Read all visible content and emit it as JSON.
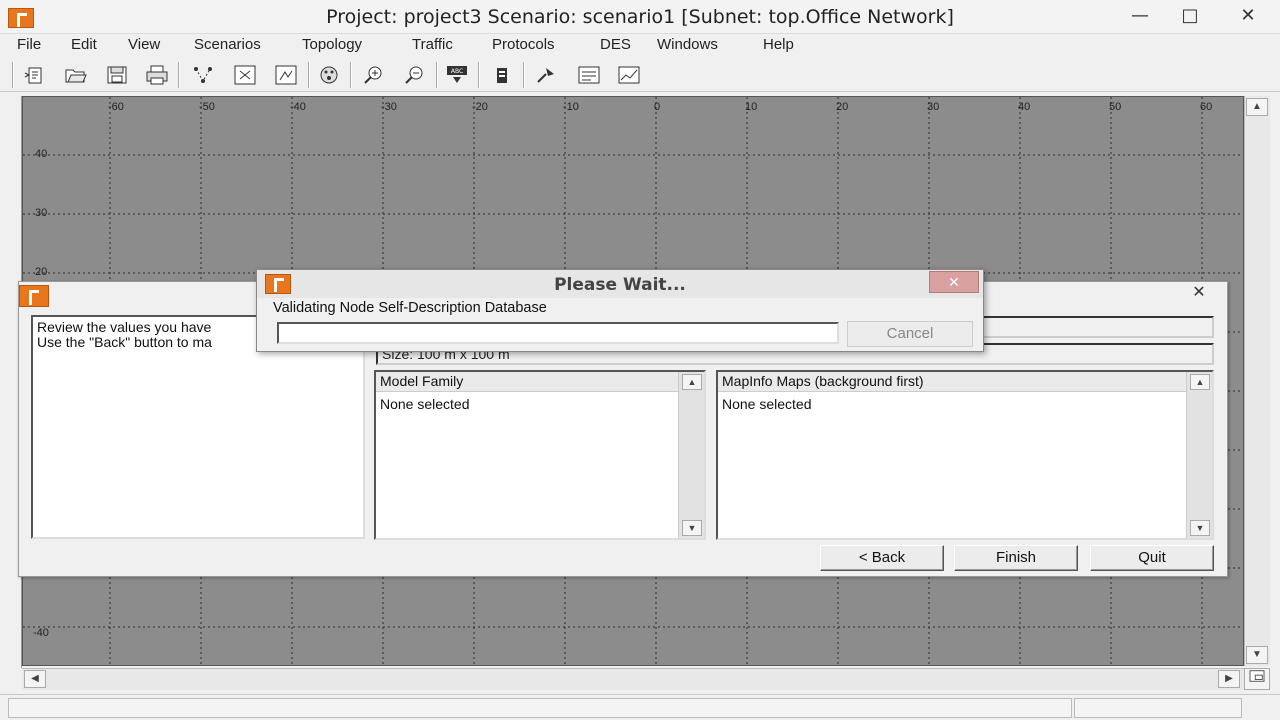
{
  "window": {
    "title": "Project: project3 Scenario: scenario1  [Subnet: top.Office Network]",
    "minimize": "—",
    "maximize": "□",
    "close": "✕"
  },
  "menu": [
    "File",
    "Edit",
    "View",
    "Scenarios",
    "Topology",
    "Traffic",
    "Protocols",
    "DES",
    "Windows",
    "Help"
  ],
  "toolbar": {
    "icons": [
      "new-project-icon",
      "open-icon",
      "save-icon",
      "print-icon",
      "rapid-config-icon",
      "fit-to-window-icon",
      "restore-view-icon",
      "object-palette-icon",
      "zoom-in-icon",
      "zoom-out-icon",
      "verify-links-icon",
      "fail-node-icon",
      "recover-icon",
      "configure-discrete-event-simulation-icon",
      "view-results-icon"
    ]
  },
  "grid": {
    "x_ticks": [
      "-60",
      "-50",
      "-40",
      "-30",
      "-20",
      "-10",
      "0",
      "10",
      "20",
      "30",
      "40",
      "50",
      "60"
    ],
    "y_ticks_top": [
      "40",
      "30",
      "20"
    ],
    "y_ticks_bottom": [
      "-40"
    ]
  },
  "wizard": {
    "instructions": "Review the values you have\nUse the \"Back\" button to ma",
    "size_field": "Size:  100 m x 100 m",
    "model_family": {
      "header": "Model Family",
      "item": "None selected"
    },
    "mapinfo": {
      "header": "MapInfo Maps (background first)",
      "item": "None selected"
    },
    "back_label": "< Back",
    "finish_label": "Finish",
    "quit_label": "Quit",
    "close": "✕"
  },
  "wait_dialog": {
    "title": "Please Wait...",
    "message": "Validating Node Self-Description Database",
    "cancel_label": "Cancel",
    "progress": 0,
    "close": "✕"
  }
}
